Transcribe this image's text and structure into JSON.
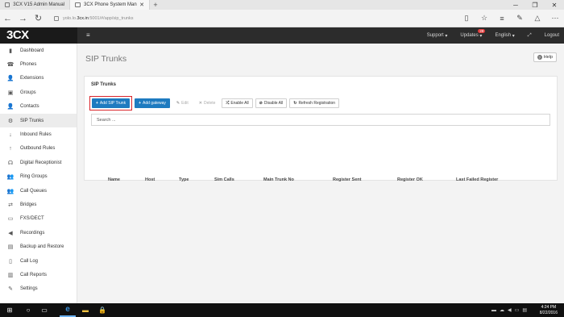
{
  "browser": {
    "tabs": [
      {
        "label": "3CX V15 Admin Manual",
        "active": false
      },
      {
        "label": "3CX Phone System Man",
        "active": true
      }
    ],
    "url_prefix": "yolo.lo.",
    "url_domain": "3cx.in",
    "url_rest": ":5001/#/app/sip_trunks"
  },
  "app": {
    "logo": "3CX",
    "nav": {
      "support": "Support",
      "updates": "Updates",
      "updates_count": "28",
      "language": "English",
      "logout": "Logout"
    }
  },
  "sidebar": {
    "items": [
      {
        "label": "Dashboard",
        "icon": "dashboard-icon",
        "glyph": "▮",
        "active": false
      },
      {
        "label": "Phones",
        "icon": "phone-icon",
        "glyph": "☎",
        "active": false
      },
      {
        "label": "Extensions",
        "icon": "user-icon",
        "glyph": "👤",
        "active": false
      },
      {
        "label": "Groups",
        "icon": "groups-icon",
        "glyph": "▣",
        "active": false
      },
      {
        "label": "Contacts",
        "icon": "contacts-icon",
        "glyph": "👤",
        "active": false
      },
      {
        "label": "SIP Trunks",
        "icon": "sip-trunk-icon",
        "glyph": "⚙",
        "active": true
      },
      {
        "label": "Inbound Rules",
        "icon": "arrow-down-icon",
        "glyph": "↓",
        "active": false
      },
      {
        "label": "Outbound Rules",
        "icon": "arrow-up-icon",
        "glyph": "↑",
        "active": false
      },
      {
        "label": "Digital Receptionist",
        "icon": "receptionist-icon",
        "glyph": "☊",
        "active": false
      },
      {
        "label": "Ring Groups",
        "icon": "ring-groups-icon",
        "glyph": "👥",
        "active": false
      },
      {
        "label": "Call Queues",
        "icon": "call-queues-icon",
        "glyph": "👥",
        "active": false
      },
      {
        "label": "Bridges",
        "icon": "bridges-icon",
        "glyph": "⇄",
        "active": false
      },
      {
        "label": "FXS/DECT",
        "icon": "fxs-icon",
        "glyph": "▭",
        "active": false
      },
      {
        "label": "Recordings",
        "icon": "recordings-icon",
        "glyph": "◀",
        "active": false
      },
      {
        "label": "Backup and Restore",
        "icon": "backup-icon",
        "glyph": "▤",
        "active": false
      },
      {
        "label": "Call Log",
        "icon": "call-log-icon",
        "glyph": "▯",
        "active": false
      },
      {
        "label": "Call Reports",
        "icon": "call-reports-icon",
        "glyph": "▥",
        "active": false
      },
      {
        "label": "Settings",
        "icon": "settings-icon",
        "glyph": "✎",
        "active": false
      }
    ]
  },
  "main": {
    "title": "SIP Trunks",
    "help": "Help",
    "panel_title": "SIP Trunks",
    "toolbar": {
      "add_sip_trunk": "Add SIP Trunk",
      "add_gateway": "Add gateway",
      "edit": "Edit",
      "delete": "Delete",
      "enable_all": "Enable All",
      "disable_all": "Disable All",
      "refresh_registration": "Refresh Registration"
    },
    "search_placeholder": "Search ...",
    "columns": [
      "Name",
      "Host",
      "Type",
      "Sim Calls",
      "Main Trunk No",
      "Register Sent",
      "Register OK",
      "Last Failed Register"
    ]
  },
  "taskbar": {
    "time": "4:24 PM",
    "date": "8/22/2016"
  },
  "colors": {
    "primary_button": "#1e7bc0",
    "highlight_border": "#d9242a",
    "header_bg": "#2c2c2c",
    "badge": "#e23b3b"
  }
}
